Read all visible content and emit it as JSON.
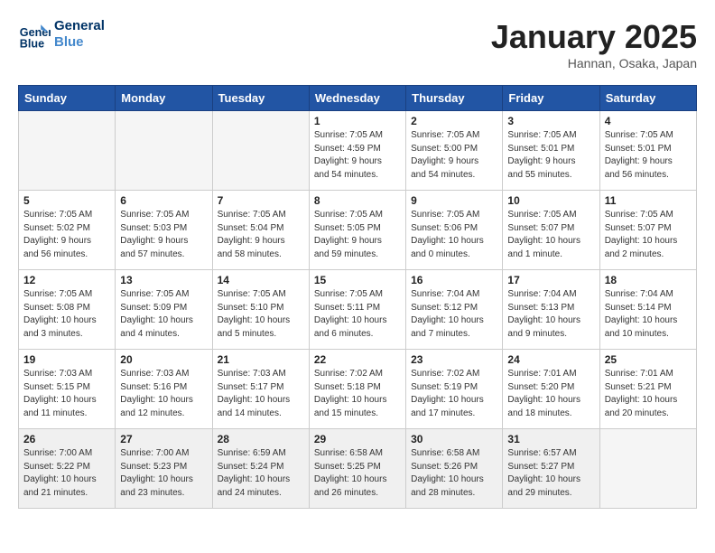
{
  "header": {
    "logo_line1": "General",
    "logo_line2": "Blue",
    "month": "January 2025",
    "location": "Hannan, Osaka, Japan"
  },
  "weekdays": [
    "Sunday",
    "Monday",
    "Tuesday",
    "Wednesday",
    "Thursday",
    "Friday",
    "Saturday"
  ],
  "weeks": [
    [
      {
        "day": "",
        "info": ""
      },
      {
        "day": "",
        "info": ""
      },
      {
        "day": "",
        "info": ""
      },
      {
        "day": "1",
        "info": "Sunrise: 7:05 AM\nSunset: 4:59 PM\nDaylight: 9 hours\nand 54 minutes."
      },
      {
        "day": "2",
        "info": "Sunrise: 7:05 AM\nSunset: 5:00 PM\nDaylight: 9 hours\nand 54 minutes."
      },
      {
        "day": "3",
        "info": "Sunrise: 7:05 AM\nSunset: 5:01 PM\nDaylight: 9 hours\nand 55 minutes."
      },
      {
        "day": "4",
        "info": "Sunrise: 7:05 AM\nSunset: 5:01 PM\nDaylight: 9 hours\nand 56 minutes."
      }
    ],
    [
      {
        "day": "5",
        "info": "Sunrise: 7:05 AM\nSunset: 5:02 PM\nDaylight: 9 hours\nand 56 minutes."
      },
      {
        "day": "6",
        "info": "Sunrise: 7:05 AM\nSunset: 5:03 PM\nDaylight: 9 hours\nand 57 minutes."
      },
      {
        "day": "7",
        "info": "Sunrise: 7:05 AM\nSunset: 5:04 PM\nDaylight: 9 hours\nand 58 minutes."
      },
      {
        "day": "8",
        "info": "Sunrise: 7:05 AM\nSunset: 5:05 PM\nDaylight: 9 hours\nand 59 minutes."
      },
      {
        "day": "9",
        "info": "Sunrise: 7:05 AM\nSunset: 5:06 PM\nDaylight: 10 hours\nand 0 minutes."
      },
      {
        "day": "10",
        "info": "Sunrise: 7:05 AM\nSunset: 5:07 PM\nDaylight: 10 hours\nand 1 minute."
      },
      {
        "day": "11",
        "info": "Sunrise: 7:05 AM\nSunset: 5:07 PM\nDaylight: 10 hours\nand 2 minutes."
      }
    ],
    [
      {
        "day": "12",
        "info": "Sunrise: 7:05 AM\nSunset: 5:08 PM\nDaylight: 10 hours\nand 3 minutes."
      },
      {
        "day": "13",
        "info": "Sunrise: 7:05 AM\nSunset: 5:09 PM\nDaylight: 10 hours\nand 4 minutes."
      },
      {
        "day": "14",
        "info": "Sunrise: 7:05 AM\nSunset: 5:10 PM\nDaylight: 10 hours\nand 5 minutes."
      },
      {
        "day": "15",
        "info": "Sunrise: 7:05 AM\nSunset: 5:11 PM\nDaylight: 10 hours\nand 6 minutes."
      },
      {
        "day": "16",
        "info": "Sunrise: 7:04 AM\nSunset: 5:12 PM\nDaylight: 10 hours\nand 7 minutes."
      },
      {
        "day": "17",
        "info": "Sunrise: 7:04 AM\nSunset: 5:13 PM\nDaylight: 10 hours\nand 9 minutes."
      },
      {
        "day": "18",
        "info": "Sunrise: 7:04 AM\nSunset: 5:14 PM\nDaylight: 10 hours\nand 10 minutes."
      }
    ],
    [
      {
        "day": "19",
        "info": "Sunrise: 7:03 AM\nSunset: 5:15 PM\nDaylight: 10 hours\nand 11 minutes."
      },
      {
        "day": "20",
        "info": "Sunrise: 7:03 AM\nSunset: 5:16 PM\nDaylight: 10 hours\nand 12 minutes."
      },
      {
        "day": "21",
        "info": "Sunrise: 7:03 AM\nSunset: 5:17 PM\nDaylight: 10 hours\nand 14 minutes."
      },
      {
        "day": "22",
        "info": "Sunrise: 7:02 AM\nSunset: 5:18 PM\nDaylight: 10 hours\nand 15 minutes."
      },
      {
        "day": "23",
        "info": "Sunrise: 7:02 AM\nSunset: 5:19 PM\nDaylight: 10 hours\nand 17 minutes."
      },
      {
        "day": "24",
        "info": "Sunrise: 7:01 AM\nSunset: 5:20 PM\nDaylight: 10 hours\nand 18 minutes."
      },
      {
        "day": "25",
        "info": "Sunrise: 7:01 AM\nSunset: 5:21 PM\nDaylight: 10 hours\nand 20 minutes."
      }
    ],
    [
      {
        "day": "26",
        "info": "Sunrise: 7:00 AM\nSunset: 5:22 PM\nDaylight: 10 hours\nand 21 minutes."
      },
      {
        "day": "27",
        "info": "Sunrise: 7:00 AM\nSunset: 5:23 PM\nDaylight: 10 hours\nand 23 minutes."
      },
      {
        "day": "28",
        "info": "Sunrise: 6:59 AM\nSunset: 5:24 PM\nDaylight: 10 hours\nand 24 minutes."
      },
      {
        "day": "29",
        "info": "Sunrise: 6:58 AM\nSunset: 5:25 PM\nDaylight: 10 hours\nand 26 minutes."
      },
      {
        "day": "30",
        "info": "Sunrise: 6:58 AM\nSunset: 5:26 PM\nDaylight: 10 hours\nand 28 minutes."
      },
      {
        "day": "31",
        "info": "Sunrise: 6:57 AM\nSunset: 5:27 PM\nDaylight: 10 hours\nand 29 minutes."
      },
      {
        "day": "",
        "info": ""
      }
    ]
  ]
}
